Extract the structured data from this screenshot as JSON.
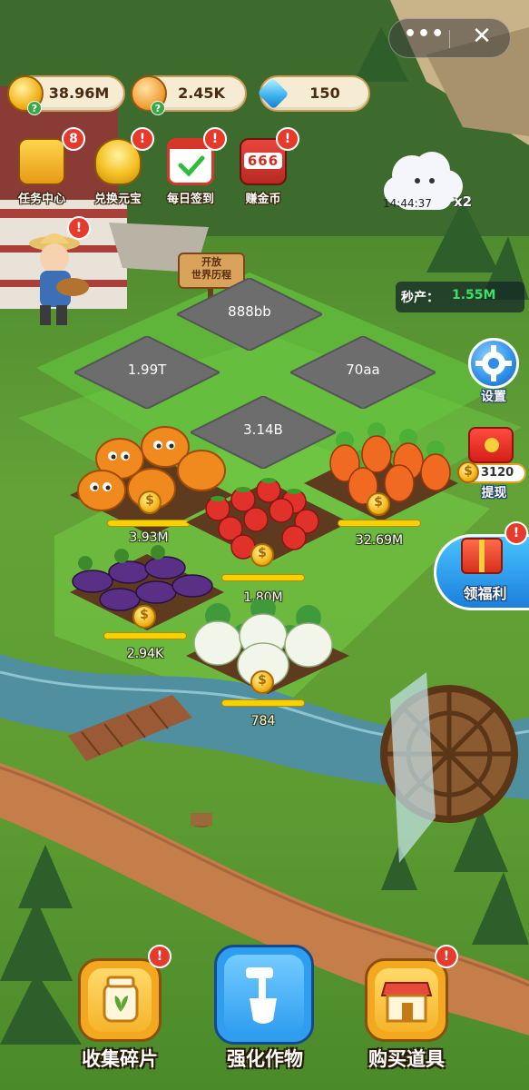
{
  "capsule": {
    "more": "•••",
    "close": "✕"
  },
  "resources": [
    {
      "icon": "gold-coin-icon",
      "value": "38.96M"
    },
    {
      "icon": "hand-coin-icon",
      "value": "2.45K"
    },
    {
      "icon": "diamond-icon",
      "value": "150"
    }
  ],
  "quick_icons": [
    {
      "label": "任务中心",
      "badge": "8",
      "icon": "treasure-chest-icon"
    },
    {
      "label": "兑换元宝",
      "badge": "!",
      "icon": "gold-ingot-icon"
    },
    {
      "label": "每日签到",
      "badge": "!",
      "icon": "calendar-check-icon"
    },
    {
      "label": "赚金币",
      "badge": "!",
      "icon": "slot-machine-icon",
      "slot_digits": "666"
    }
  ],
  "farmer_badge": "!",
  "sign": "开放\n世界历程",
  "weather": {
    "timer": "14:44:37",
    "multiplier": "x2"
  },
  "production": {
    "label": "秒产：",
    "value": "1.55M"
  },
  "empty_plots": [
    "888bb",
    "1.99T",
    "70aa",
    "3.14B"
  ],
  "crops": [
    {
      "name": "pumpkin",
      "output": "3.93M",
      "progress": 1.0
    },
    {
      "name": "tomato",
      "output": "1.80M",
      "progress": 1.0
    },
    {
      "name": "carrot",
      "output": "32.69M",
      "progress": 1.0
    },
    {
      "name": "eggplant",
      "output": "2.94K",
      "progress": 1.0
    },
    {
      "name": "radish",
      "output": "784",
      "progress": 1.0
    }
  ],
  "side": {
    "settings": "设置",
    "withdraw_amount": "3120",
    "withdraw": "提现",
    "welfare": "领福利",
    "welfare_badge": "!"
  },
  "bottom": [
    {
      "label": "收集碎片",
      "badge": "!",
      "icon": "seed-jar-icon"
    },
    {
      "label": "强化作物",
      "icon": "shovel-icon"
    },
    {
      "label": "购买道具",
      "badge": "!",
      "icon": "shop-icon"
    }
  ],
  "colors": {
    "accent_green": "#3fe06a",
    "badge_red": "#e53a2c",
    "gold": "#f6d200"
  }
}
